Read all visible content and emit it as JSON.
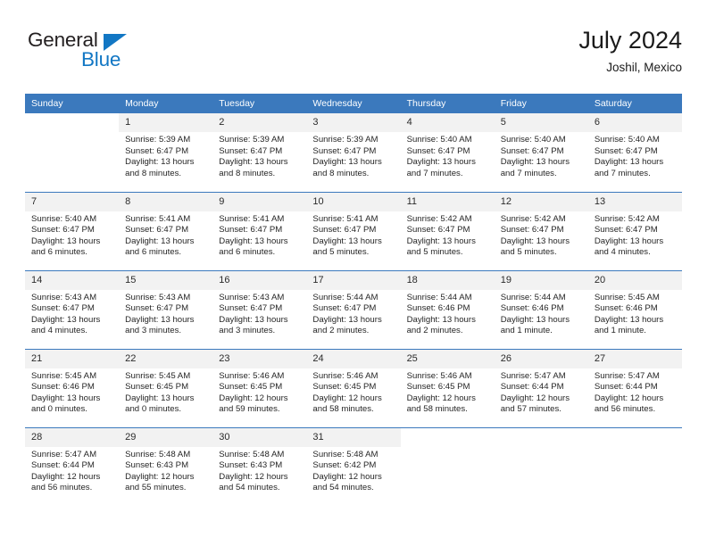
{
  "logo": {
    "word_top": "General",
    "word_bottom": "Blue",
    "triangle_icon": "triangle-icon",
    "accent_color": "#1277c4"
  },
  "header": {
    "title": "July 2024",
    "location": "Joshil, Mexico"
  },
  "theme": {
    "header_blue": "#3b79bd",
    "daynum_gray": "#f2f2f2",
    "text": "#262626"
  },
  "calendar": {
    "weekday_headers": [
      "Sunday",
      "Monday",
      "Tuesday",
      "Wednesday",
      "Thursday",
      "Friday",
      "Saturday"
    ],
    "weeks": [
      [
        {
          "day": "",
          "blank": true
        },
        {
          "day": "1",
          "sunrise": "Sunrise: 5:39 AM",
          "sunset": "Sunset: 6:47 PM",
          "daylight": "Daylight: 13 hours and 8 minutes."
        },
        {
          "day": "2",
          "sunrise": "Sunrise: 5:39 AM",
          "sunset": "Sunset: 6:47 PM",
          "daylight": "Daylight: 13 hours and 8 minutes."
        },
        {
          "day": "3",
          "sunrise": "Sunrise: 5:39 AM",
          "sunset": "Sunset: 6:47 PM",
          "daylight": "Daylight: 13 hours and 8 minutes."
        },
        {
          "day": "4",
          "sunrise": "Sunrise: 5:40 AM",
          "sunset": "Sunset: 6:47 PM",
          "daylight": "Daylight: 13 hours and 7 minutes."
        },
        {
          "day": "5",
          "sunrise": "Sunrise: 5:40 AM",
          "sunset": "Sunset: 6:47 PM",
          "daylight": "Daylight: 13 hours and 7 minutes."
        },
        {
          "day": "6",
          "sunrise": "Sunrise: 5:40 AM",
          "sunset": "Sunset: 6:47 PM",
          "daylight": "Daylight: 13 hours and 7 minutes."
        }
      ],
      [
        {
          "day": "7",
          "sunrise": "Sunrise: 5:40 AM",
          "sunset": "Sunset: 6:47 PM",
          "daylight": "Daylight: 13 hours and 6 minutes."
        },
        {
          "day": "8",
          "sunrise": "Sunrise: 5:41 AM",
          "sunset": "Sunset: 6:47 PM",
          "daylight": "Daylight: 13 hours and 6 minutes."
        },
        {
          "day": "9",
          "sunrise": "Sunrise: 5:41 AM",
          "sunset": "Sunset: 6:47 PM",
          "daylight": "Daylight: 13 hours and 6 minutes."
        },
        {
          "day": "10",
          "sunrise": "Sunrise: 5:41 AM",
          "sunset": "Sunset: 6:47 PM",
          "daylight": "Daylight: 13 hours and 5 minutes."
        },
        {
          "day": "11",
          "sunrise": "Sunrise: 5:42 AM",
          "sunset": "Sunset: 6:47 PM",
          "daylight": "Daylight: 13 hours and 5 minutes."
        },
        {
          "day": "12",
          "sunrise": "Sunrise: 5:42 AM",
          "sunset": "Sunset: 6:47 PM",
          "daylight": "Daylight: 13 hours and 5 minutes."
        },
        {
          "day": "13",
          "sunrise": "Sunrise: 5:42 AM",
          "sunset": "Sunset: 6:47 PM",
          "daylight": "Daylight: 13 hours and 4 minutes."
        }
      ],
      [
        {
          "day": "14",
          "sunrise": "Sunrise: 5:43 AM",
          "sunset": "Sunset: 6:47 PM",
          "daylight": "Daylight: 13 hours and 4 minutes."
        },
        {
          "day": "15",
          "sunrise": "Sunrise: 5:43 AM",
          "sunset": "Sunset: 6:47 PM",
          "daylight": "Daylight: 13 hours and 3 minutes."
        },
        {
          "day": "16",
          "sunrise": "Sunrise: 5:43 AM",
          "sunset": "Sunset: 6:47 PM",
          "daylight": "Daylight: 13 hours and 3 minutes."
        },
        {
          "day": "17",
          "sunrise": "Sunrise: 5:44 AM",
          "sunset": "Sunset: 6:47 PM",
          "daylight": "Daylight: 13 hours and 2 minutes."
        },
        {
          "day": "18",
          "sunrise": "Sunrise: 5:44 AM",
          "sunset": "Sunset: 6:46 PM",
          "daylight": "Daylight: 13 hours and 2 minutes."
        },
        {
          "day": "19",
          "sunrise": "Sunrise: 5:44 AM",
          "sunset": "Sunset: 6:46 PM",
          "daylight": "Daylight: 13 hours and 1 minute."
        },
        {
          "day": "20",
          "sunrise": "Sunrise: 5:45 AM",
          "sunset": "Sunset: 6:46 PM",
          "daylight": "Daylight: 13 hours and 1 minute."
        }
      ],
      [
        {
          "day": "21",
          "sunrise": "Sunrise: 5:45 AM",
          "sunset": "Sunset: 6:46 PM",
          "daylight": "Daylight: 13 hours and 0 minutes."
        },
        {
          "day": "22",
          "sunrise": "Sunrise: 5:45 AM",
          "sunset": "Sunset: 6:45 PM",
          "daylight": "Daylight: 13 hours and 0 minutes."
        },
        {
          "day": "23",
          "sunrise": "Sunrise: 5:46 AM",
          "sunset": "Sunset: 6:45 PM",
          "daylight": "Daylight: 12 hours and 59 minutes."
        },
        {
          "day": "24",
          "sunrise": "Sunrise: 5:46 AM",
          "sunset": "Sunset: 6:45 PM",
          "daylight": "Daylight: 12 hours and 58 minutes."
        },
        {
          "day": "25",
          "sunrise": "Sunrise: 5:46 AM",
          "sunset": "Sunset: 6:45 PM",
          "daylight": "Daylight: 12 hours and 58 minutes."
        },
        {
          "day": "26",
          "sunrise": "Sunrise: 5:47 AM",
          "sunset": "Sunset: 6:44 PM",
          "daylight": "Daylight: 12 hours and 57 minutes."
        },
        {
          "day": "27",
          "sunrise": "Sunrise: 5:47 AM",
          "sunset": "Sunset: 6:44 PM",
          "daylight": "Daylight: 12 hours and 56 minutes."
        }
      ],
      [
        {
          "day": "28",
          "sunrise": "Sunrise: 5:47 AM",
          "sunset": "Sunset: 6:44 PM",
          "daylight": "Daylight: 12 hours and 56 minutes."
        },
        {
          "day": "29",
          "sunrise": "Sunrise: 5:48 AM",
          "sunset": "Sunset: 6:43 PM",
          "daylight": "Daylight: 12 hours and 55 minutes."
        },
        {
          "day": "30",
          "sunrise": "Sunrise: 5:48 AM",
          "sunset": "Sunset: 6:43 PM",
          "daylight": "Daylight: 12 hours and 54 minutes."
        },
        {
          "day": "31",
          "sunrise": "Sunrise: 5:48 AM",
          "sunset": "Sunset: 6:42 PM",
          "daylight": "Daylight: 12 hours and 54 minutes."
        },
        {
          "day": "",
          "blank": true
        },
        {
          "day": "",
          "blank": true
        },
        {
          "day": "",
          "blank": true
        }
      ]
    ]
  }
}
